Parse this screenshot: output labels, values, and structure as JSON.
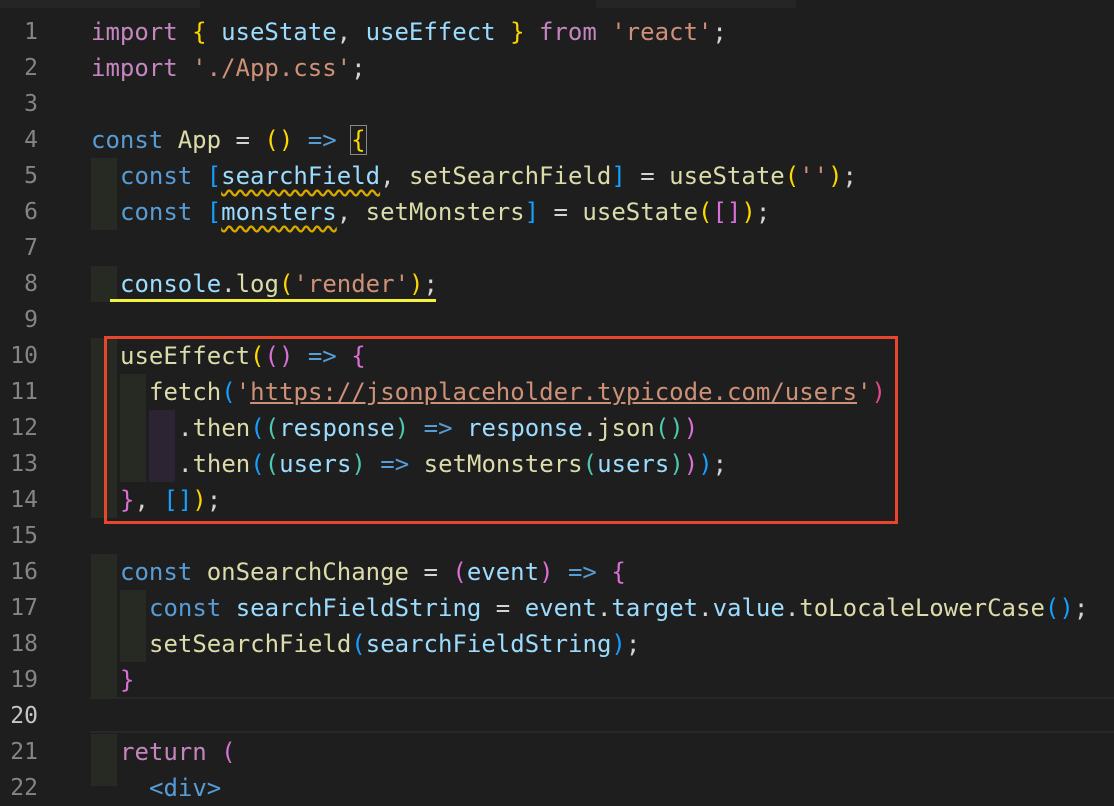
{
  "editor": {
    "language": "javascript",
    "active_line": 20,
    "line_numbers": [
      "1",
      "2",
      "3",
      "4",
      "5",
      "6",
      "7",
      "8",
      "9",
      "10",
      "11",
      "12",
      "13",
      "14",
      "15",
      "16",
      "17",
      "18",
      "19",
      "20",
      "21",
      "22"
    ],
    "tokens": {
      "l1": [
        "import",
        " ",
        "{",
        " ",
        "useState",
        ", ",
        "useEffect",
        " ",
        "}",
        " ",
        "from",
        " ",
        "'react'",
        ";"
      ],
      "l2": [
        "import",
        " ",
        "'./App.css'",
        ";"
      ],
      "l4": [
        "const",
        " ",
        "App",
        " = ",
        "(",
        ")",
        " => ",
        "{"
      ],
      "l5": [
        "const",
        " ",
        "[",
        "searchField",
        ", ",
        "setSearchField",
        "]",
        " = ",
        "useState",
        "(",
        "''",
        ")",
        ";"
      ],
      "l6": [
        "const",
        " ",
        "[",
        "monsters",
        ", ",
        "setMonsters",
        "]",
        " = ",
        "useState",
        "(",
        "[",
        "]",
        ")",
        ";"
      ],
      "l8": [
        "console",
        ".",
        "log",
        "(",
        "'render'",
        ")",
        ";"
      ],
      "l10": [
        "useEffect",
        "(",
        "(",
        ")",
        " => ",
        "{"
      ],
      "l11_fetch": "fetch",
      "l11_open": "(",
      "l11_q1": "'",
      "l11_url": "https://jsonplaceholder.typicode.com/users",
      "l11_q2": "'",
      "l11_close": ")",
      "l12": [
        ".",
        "then",
        "(",
        "(",
        "response",
        ")",
        " => ",
        "response",
        ".",
        "json",
        "(",
        ")",
        ")"
      ],
      "l13": [
        ".",
        "then",
        "(",
        "(",
        "users",
        ")",
        " => ",
        "setMonsters",
        "(",
        "users",
        ")",
        ")",
        ")",
        ";"
      ],
      "l14": [
        "}",
        ", ",
        "[",
        "]",
        ")",
        ";"
      ],
      "l16": [
        "const",
        " ",
        "onSearchChange",
        " = ",
        "(",
        "event",
        ")",
        " => ",
        "{"
      ],
      "l17": [
        "const",
        " ",
        "searchFieldString",
        " = ",
        "event",
        ".",
        "target",
        ".",
        "value",
        ".",
        "toLocaleLowerCase",
        "(",
        ")",
        ";"
      ],
      "l18": [
        "setSearchField",
        "(",
        "searchFieldString",
        ")",
        ";"
      ],
      "l19": [
        "}"
      ],
      "l21": [
        "return",
        " ",
        "("
      ],
      "l22": [
        "<div>"
      ]
    }
  },
  "annotation": {
    "box_color": "#e8452e",
    "underline_color": "#f3f33f"
  }
}
